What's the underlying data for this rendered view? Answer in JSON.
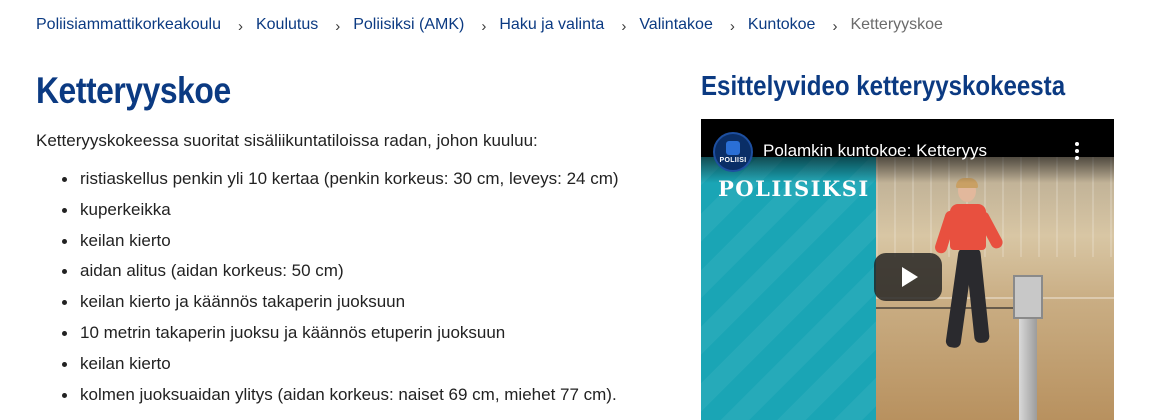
{
  "breadcrumb": {
    "items": [
      {
        "label": "Poliisiammattikorkeakoulu"
      },
      {
        "label": "Koulutus"
      },
      {
        "label": "Poliisiksi (AMK)"
      },
      {
        "label": "Haku ja valinta"
      },
      {
        "label": "Valintakoe"
      },
      {
        "label": "Kuntokoe"
      }
    ],
    "current": "Ketteryyskoe",
    "separator": "›"
  },
  "main": {
    "title": "Ketteryyskoe",
    "intro": "Ketteryyskokeessa suoritat sisäliikuntatiloissa radan, johon kuuluu:",
    "list": [
      "ristiaskellus penkin yli 10 kertaa (penkin korkeus: 30 cm, leveys: 24 cm)",
      "kuperkeikka",
      "keilan kierto",
      "aidan alitus (aidan korkeus: 50 cm)",
      "keilan kierto ja käännös takaperin juoksuun",
      "10 metrin takaperin juoksu ja käännös etuperin juoksuun",
      "keilan kierto",
      "kolmen juoksuaidan ylitys (aidan korkeus: naiset 69 cm, miehet 77 cm)."
    ]
  },
  "side": {
    "title": "Esittelyvideo ketteryyskokeesta",
    "video": {
      "title": "Polamkin kuntokoe: Ketteryys",
      "channel_logo_text": "POLIISI",
      "overlay_brand": "POLIISIKSI",
      "icons": {
        "play": "play-icon",
        "more": "more-vert-icon"
      }
    }
  },
  "colors": {
    "link": "#0b3a82",
    "heading": "#0b3a82",
    "muted": "#6b6b6b",
    "teal": "#1aa5b5",
    "runner_shirt": "#e8503f"
  }
}
